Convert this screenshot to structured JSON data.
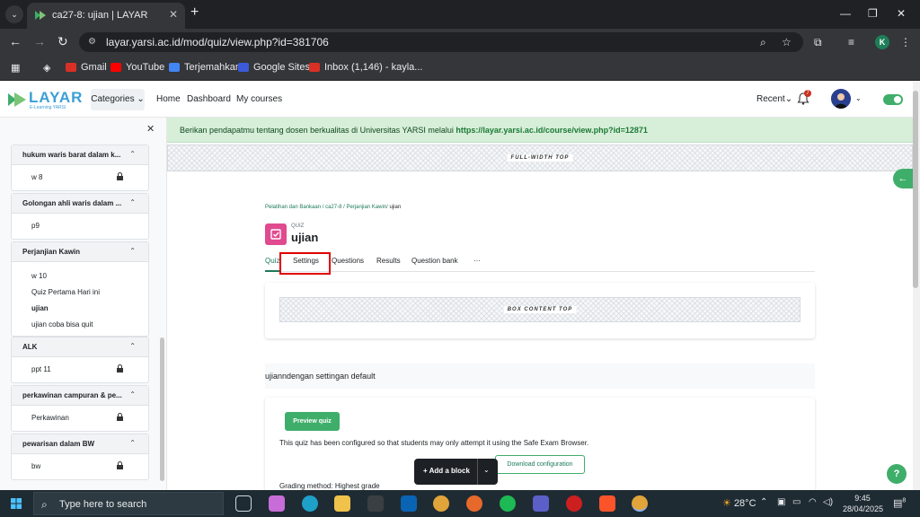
{
  "browser": {
    "tab_title": "ca27-8: ujian | LAYAR",
    "url": "layar.yarsi.ac.id/mod/quiz/view.php?id=381706",
    "profile_initial": "K",
    "bookmarks": [
      {
        "label": "Gmail",
        "color": "#d93025"
      },
      {
        "label": "YouTube",
        "color": "#ff0000"
      },
      {
        "label": "Terjemahkan",
        "color": "#4285f4"
      },
      {
        "label": "Google Sites",
        "color": "#3b5bdb"
      },
      {
        "label": "Inbox (1,146) - kayla...",
        "color": "#d93025"
      }
    ]
  },
  "header": {
    "logo_text": "LAYAR",
    "logo_sub": "E-Learning YARSI",
    "categories": "Categories",
    "nav": [
      "Home",
      "Dashboard",
      "My courses"
    ],
    "recent": "Recent",
    "notification_count": "7",
    "brand_color": "#3fae6a"
  },
  "drawer": {
    "sections": [
      {
        "title": "hukum waris barat dalam k...",
        "items": [
          {
            "label": "w 8",
            "locked": true,
            "bold": false
          }
        ]
      },
      {
        "title": "Golongan ahli waris dalam ...",
        "items": [
          {
            "label": "p9",
            "locked": false,
            "bold": false
          }
        ]
      },
      {
        "title": "Perjanjian Kawin",
        "items": [
          {
            "label": "w 10",
            "locked": false,
            "bold": false
          },
          {
            "label": "Quiz Pertama Hari ini",
            "locked": false,
            "bold": false
          },
          {
            "label": "ujian",
            "locked": false,
            "bold": true
          },
          {
            "label": "ujian coba bisa quit",
            "locked": false,
            "bold": false
          }
        ]
      },
      {
        "title": "ALK",
        "items": [
          {
            "label": "ppt 11",
            "locked": true,
            "bold": false
          }
        ]
      },
      {
        "title": "perkawinan campuran & pe...",
        "items": [
          {
            "label": "Perkawinan",
            "locked": true,
            "bold": false
          }
        ]
      },
      {
        "title": "pewarisan dalam BW",
        "items": [
          {
            "label": "bw",
            "locked": true,
            "bold": false
          }
        ]
      }
    ]
  },
  "notice": {
    "text": "Berikan pendapatmu tentang dosen berkualitas di Universitas YARSI melalui ",
    "link": "https://layar.yarsi.ac.id/course/view.php?id=12871"
  },
  "full_width_top": "FULL-WIDTH TOP",
  "breadcrumb": {
    "parts": [
      "Pelatihan dan Bankaan",
      "ca27-8",
      "Perjanjian Kawin"
    ],
    "current": "ujian"
  },
  "quiz": {
    "type": "QUIZ",
    "title": "ujian",
    "tabs": [
      "Quiz",
      "Settings",
      "Questions",
      "Results",
      "Question bank",
      "···"
    ],
    "box_content_top": "BOX CONTENT TOP",
    "description": "ujianndengan settingan default",
    "preview_button": "Preview quiz",
    "seb_text": "This quiz has been configured so that students may only attempt it using the Safe Exam Browser.",
    "download_button": "Download configuration",
    "grading": "Grading method: Highest grade"
  },
  "add_block": "+ Add a block",
  "help": "?",
  "taskbar": {
    "search_placeholder": "Type here to search",
    "weather": "28°C",
    "time": "9:45",
    "date": "28/04/2025",
    "notification_count": "8"
  }
}
